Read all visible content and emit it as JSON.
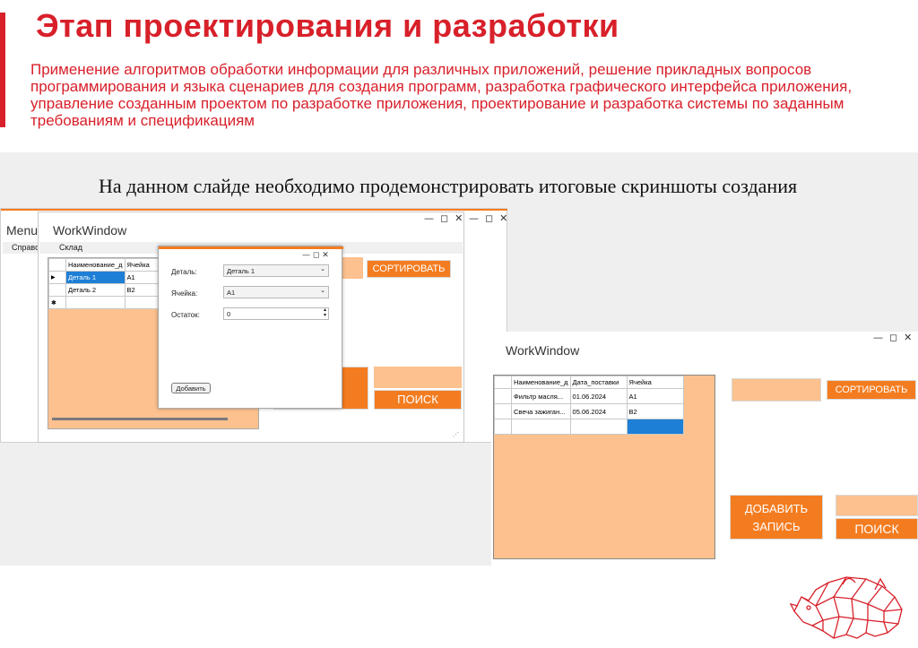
{
  "slide": {
    "title": "Этап проектирования и разработки",
    "subtitle": "Применение алгоритмов обработки информации для различных приложений, решение прикладных вопросов программирования и языка сценариев для создания программ, разработка графического интерфейса приложения, управление созданным проектом по разработке приложения, проектирование и разработка системы по заданным требованиям и спецификациям",
    "body_text": "На данном слайде необходимо продемонстрировать итоговые скриншоты создания"
  },
  "colors": {
    "accent": "#d8202a",
    "button_orange": "#f47c20",
    "panel_orange": "#fcc18e",
    "selection_blue": "#1e7fd6"
  },
  "icons": {
    "minimize": "minimize-icon",
    "maximize": "maximize-icon",
    "close": "close-icon",
    "logo": "rhino-logo"
  },
  "window_controls": {
    "minimize": "—",
    "maximize": "◻",
    "close": "✕"
  },
  "menu_window": {
    "title": "Menu",
    "menu_item": "Справочн"
  },
  "work_window_left": {
    "title": "WorkWindow",
    "menu_item": "Склад",
    "grid": {
      "headers": [
        "Наименование_д",
        "Ячейка"
      ],
      "rows": [
        [
          "Деталь 1",
          "A1"
        ],
        [
          "Деталь 2",
          "B2"
        ]
      ]
    },
    "sort_button": "СОРТИРОВАТЬ",
    "search_button": "ПОИСК"
  },
  "add_dialog": {
    "detail_label": "Деталь:",
    "detail_value": "Деталь 1",
    "cell_label": "Ячейка:",
    "cell_value": "A1",
    "rest_label": "Остаток:",
    "rest_value": "0",
    "add_button": "Добавить"
  },
  "work_window_right": {
    "title": "WorkWindow",
    "grid": {
      "headers": [
        "Наименование_д",
        "Дата_поставки",
        "Ячейка"
      ],
      "rows": [
        [
          "Фильтр масля...",
          "01.06.2024",
          "A1"
        ],
        [
          "Свеча зажиган...",
          "05.06.2024",
          "B2"
        ]
      ]
    },
    "sort_button": "СОРТИРОВАТЬ",
    "add_record_button": "ДОБАВИТЬ ЗАПИСЬ",
    "search_button": "ПОИСК"
  }
}
